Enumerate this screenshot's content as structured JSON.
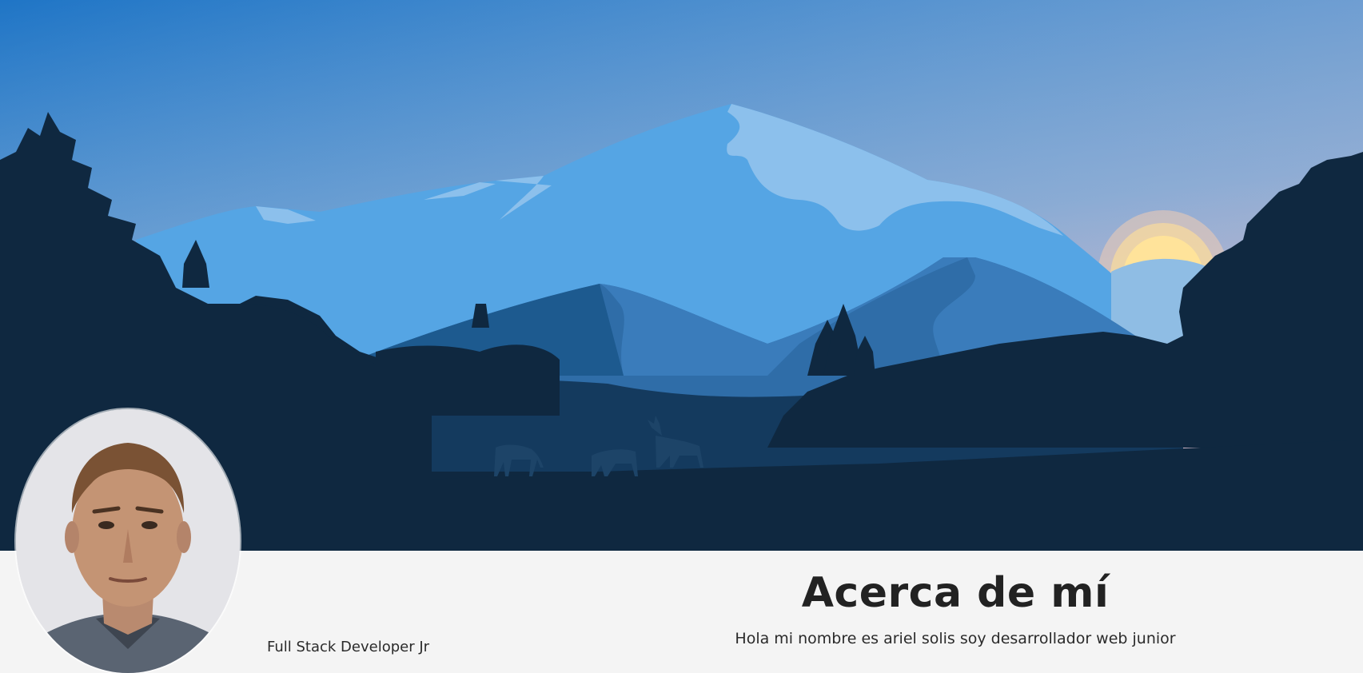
{
  "hero": {
    "image": "mountain-landscape-illustration",
    "colors": {
      "sky_top": "#2077c8",
      "sky_bottom": "#d6b4c4",
      "mountain_light": "#55a5e4",
      "mountain_snow": "#8cc0ec",
      "mountain_mid": "#2f6da8",
      "forest": "#0f2840",
      "sun": "#ffe29a"
    }
  },
  "profile": {
    "avatar": "profile-photo",
    "role": "Full Stack Developer Jr"
  },
  "about": {
    "title": "Acerca de mí",
    "text": "Hola mi nombre es ariel solis soy desarrollador web junior"
  }
}
